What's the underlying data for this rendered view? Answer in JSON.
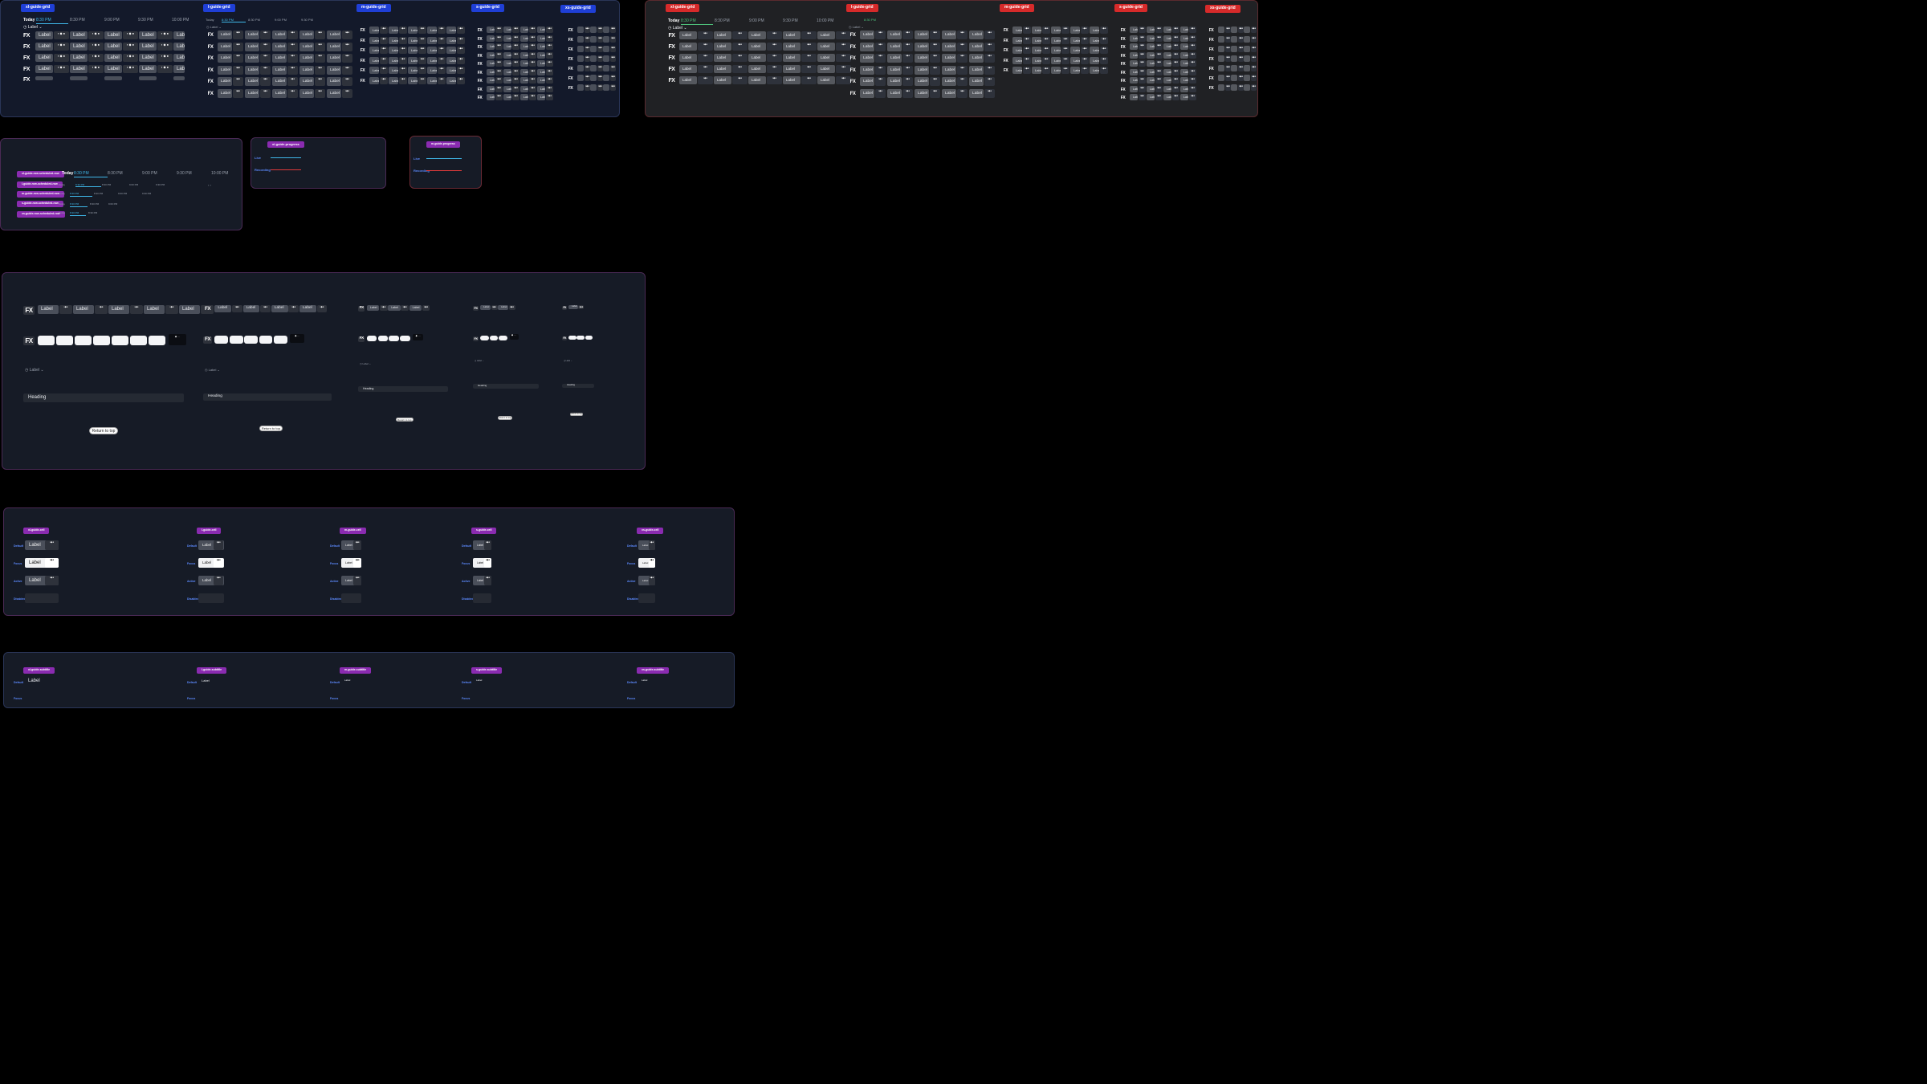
{
  "grid_tags": {
    "t1": "xl-guide-grid",
    "t2": "l-guide-grid",
    "t3": "m-guide-grid",
    "t4": "s-guide-grid",
    "t5": "xs-guide-grid"
  },
  "timeline": {
    "today": "Today",
    "times": [
      "8:30 PM",
      "8:30 PM",
      "9:00 PM",
      "9:30 PM",
      "10:00 PM"
    ]
  },
  "channel": {
    "logo": "FX",
    "label": "Label",
    "sort_icon": "chevron-down-icon"
  },
  "program_tags": {
    "labels": [
      "xl-guide-row-scheduled-row",
      "l-guide-row-scheduled-row",
      "m-guide-row-scheduled-row",
      "s-guide-row-scheduled-row",
      "xs-guide-row-scheduled-row"
    ]
  },
  "progress": {
    "tag1": "xl-guide-progress",
    "tag2": "m-guide-progress",
    "live": "Live",
    "recording": "Recording",
    "colors": {
      "live": "#3fb7e8",
      "recording": "#e03a3a"
    }
  },
  "misc": {
    "heading": "Heading",
    "back_button": "Return to top"
  },
  "cell_tags": {
    "labels": [
      "xl-guide-cell",
      "l-guide-cell",
      "m-guide-cell",
      "s-guide-cell",
      "xs-guide-cell"
    ]
  },
  "states": {
    "default": "Default",
    "focus": "Focus",
    "active": "Active",
    "disabled": "Disabled"
  },
  "subtitle_tags": {
    "labels": [
      "xl-guide-subtitle",
      "l-guide-subtitle",
      "m-guide-subtitle",
      "s-guide-subtitle",
      "xs-guide-subtitle"
    ]
  },
  "colors": {
    "blue_frame": "#13192a",
    "gray_frame": "#202124",
    "navy": "#161b26",
    "accent": "#3fb7e8",
    "tag_blue": "#1f3fd6",
    "tag_red": "#d62a2a",
    "tag_purple": "#8a2bb0"
  }
}
